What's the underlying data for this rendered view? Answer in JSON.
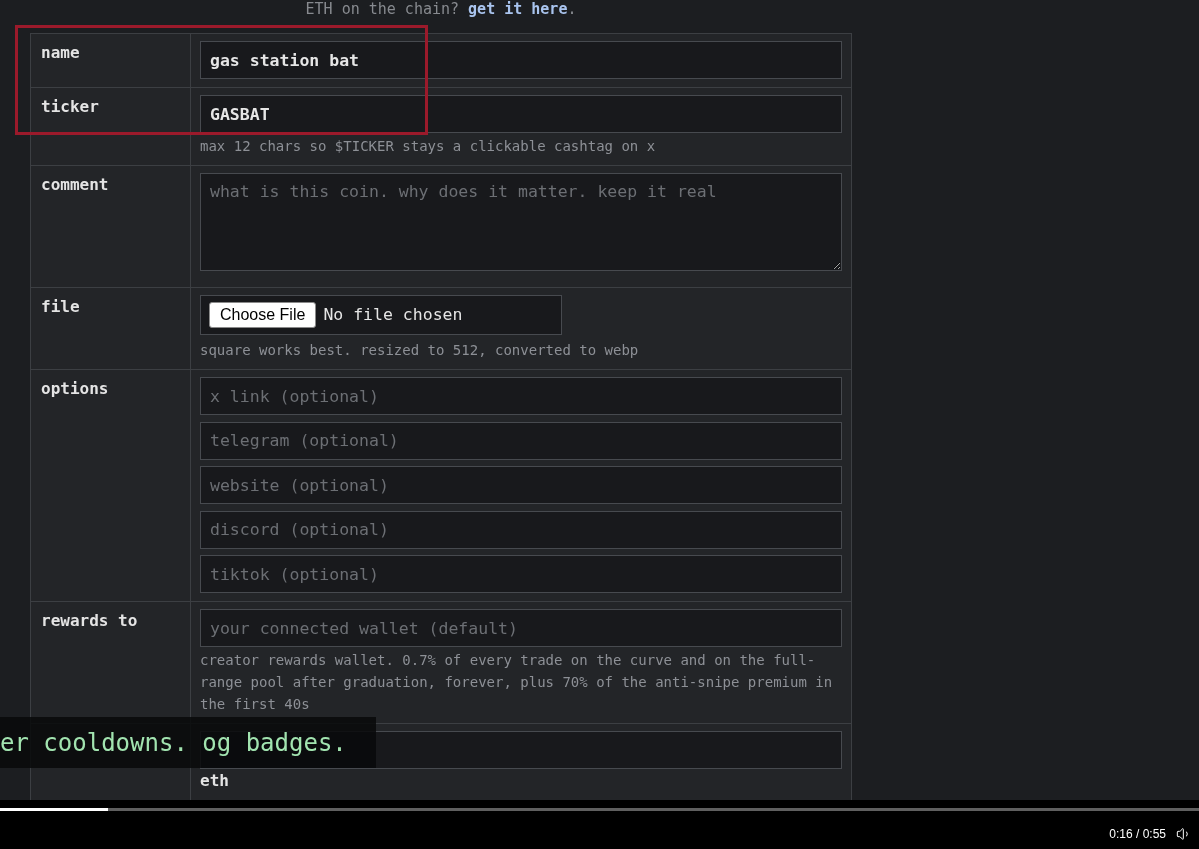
{
  "notice": {
    "text": "ETH on the chain?",
    "link": "get it here",
    "end": "."
  },
  "form": {
    "rows": [
      {
        "label": "name",
        "kind": "text",
        "value": "gas station bat"
      },
      {
        "label": "ticker",
        "kind": "text",
        "value": "GASBAT",
        "hint": "max 12 chars so $TICKER stays a clickable cashtag on x"
      },
      {
        "label": "comment",
        "kind": "textarea",
        "placeholder": "what is this coin. why does it matter. keep it real"
      },
      {
        "label": "file",
        "kind": "file",
        "button": "Choose File",
        "status": "No file chosen",
        "hint": "square works best. resized to 512, converted to webp"
      },
      {
        "label": "options",
        "kind": "group",
        "fields": [
          {
            "placeholder": "x link (optional)"
          },
          {
            "placeholder": "telegram (optional)"
          },
          {
            "placeholder": "website (optional)"
          },
          {
            "placeholder": "discord (optional)"
          },
          {
            "placeholder": "tiktok (optional)"
          }
        ]
      },
      {
        "label": "rewards to",
        "kind": "text",
        "placeholder": "your connected wallet (default)",
        "hint": "creator rewards wallet. 0.7% of every trade on the curve and on the full-range pool after graduation, forever, plus 70% of the anti-snipe premium in the first 40s"
      },
      {
        "kind": "text",
        "unit": "eth"
      }
    ]
  },
  "caption": {
    "text": "er cooldowns. og badges."
  },
  "video": {
    "progress": {
      "level": 0.09
    },
    "time": "0:16 / 0:55"
  }
}
